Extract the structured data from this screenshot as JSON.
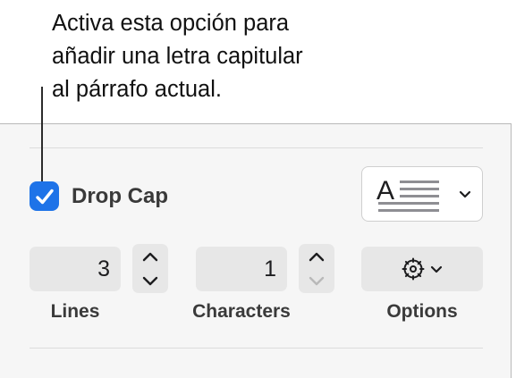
{
  "callout": {
    "lines": [
      "Activa esta opción para",
      "añadir una letra capitular",
      "al párrafo actual."
    ]
  },
  "drop_cap": {
    "label": "Drop Cap",
    "checked": true,
    "style_glyph_letter": "A"
  },
  "lines_field": {
    "value": "3",
    "caption": "Lines"
  },
  "characters_field": {
    "value": "1",
    "caption": "Characters"
  },
  "options": {
    "caption": "Options"
  },
  "colors": {
    "accent": "#1e73e8",
    "panel": "#f6f6f6",
    "field": "#e7e7e7"
  }
}
